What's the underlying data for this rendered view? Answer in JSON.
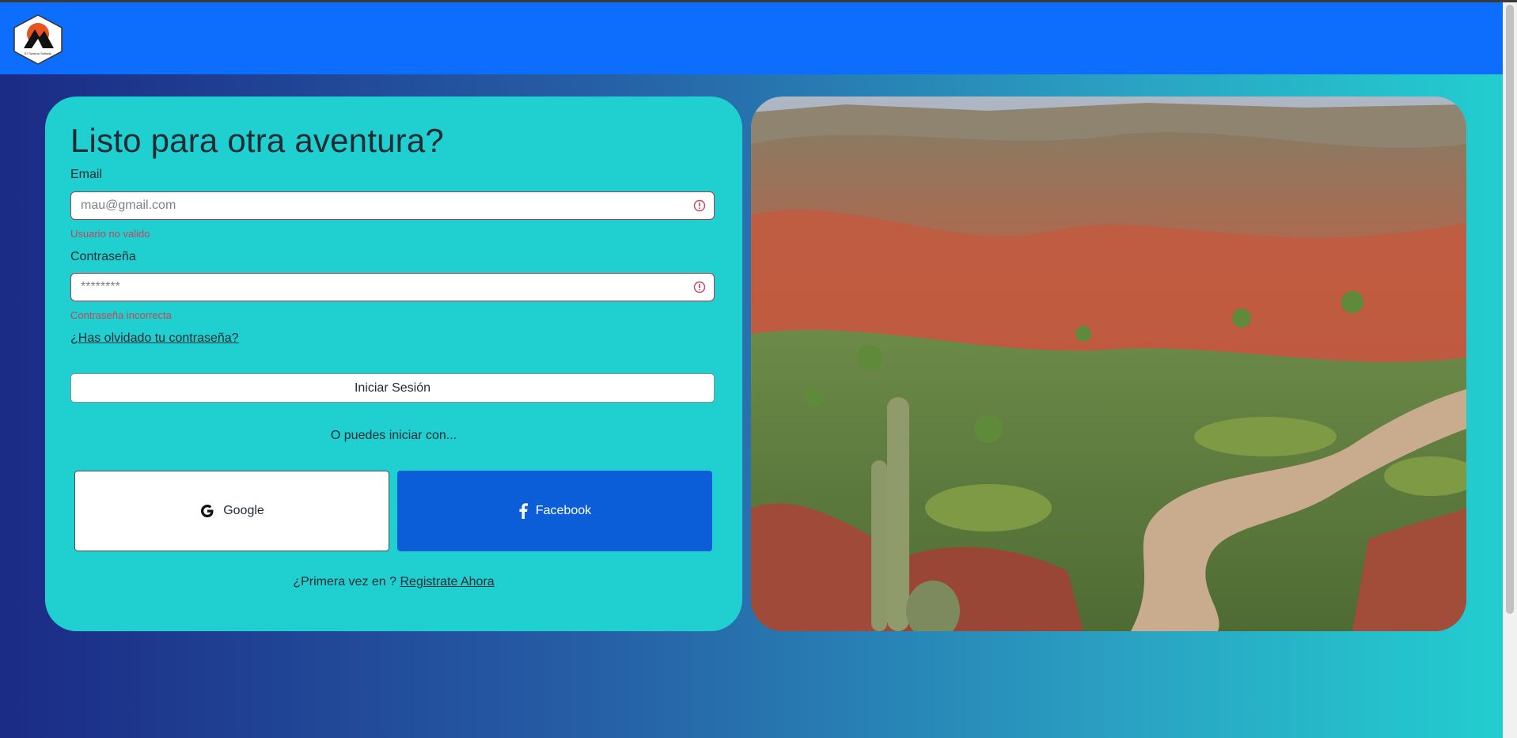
{
  "header": {
    "logo_caption": "El Turismo Soñado"
  },
  "login": {
    "title": "Listo para otra aventura?",
    "email_label": "Email",
    "email_placeholder": "mau@gmail.com",
    "email_error": "Usuario no valido",
    "password_label": "Contraseña",
    "password_placeholder": "********",
    "password_error": "Contraseña incorrecta",
    "forgot_link": "¿Has olvidado tu contraseña?",
    "submit_label": "Iniciar Sesión",
    "alt_login_text": "O puedes iniciar con...",
    "google_label": "Google",
    "facebook_label": "Facebook",
    "register_prompt": "¿Primera vez en ?",
    "register_link": "Registrate Ahora"
  },
  "colors": {
    "navbar": "#0d6efd",
    "card": "#20cfd0",
    "facebook": "#0b5ed7",
    "error": "#c2465c"
  },
  "icons": {
    "logo": "mountain-logo-icon",
    "error": "error-icon",
    "google": "google-icon",
    "facebook": "facebook-icon"
  },
  "hero_image": {
    "description": "landscape-photo"
  }
}
